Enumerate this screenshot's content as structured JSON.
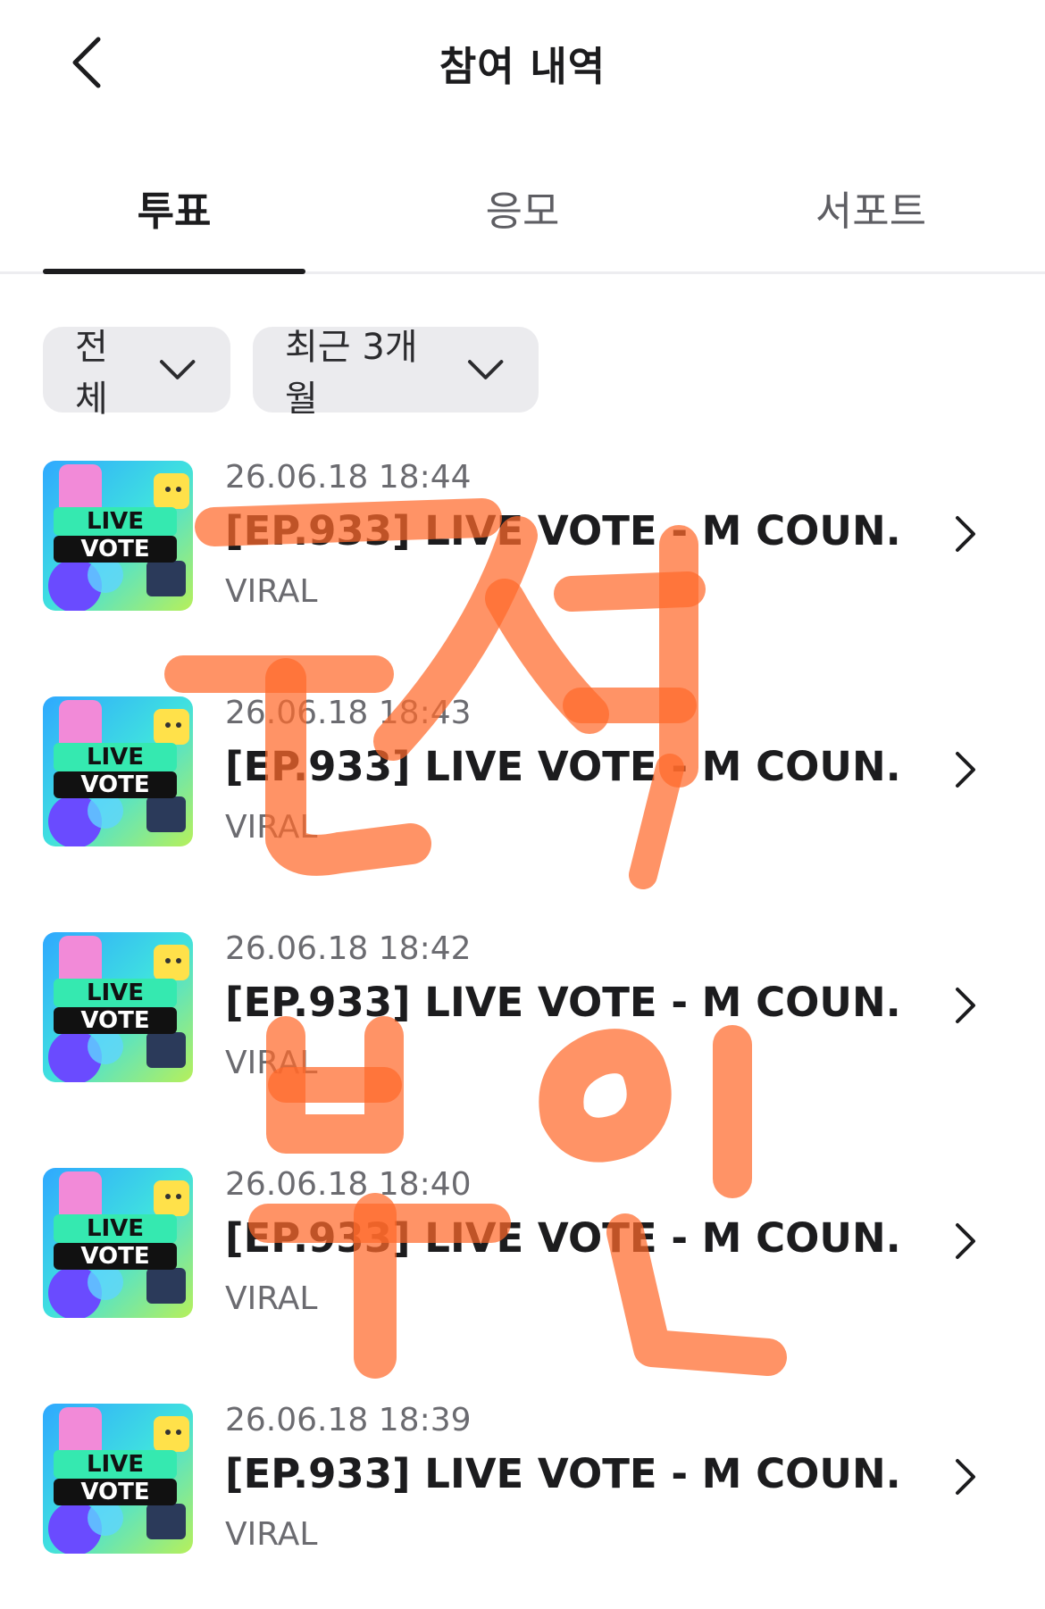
{
  "header": {
    "title": "참여 내역",
    "back_icon": "chevron-left-icon"
  },
  "tabs": [
    {
      "label": "투표",
      "active": true
    },
    {
      "label": "응모",
      "active": false
    },
    {
      "label": "서포트",
      "active": false
    }
  ],
  "filters": {
    "category": {
      "label": "전체",
      "icon": "chevron-down-icon"
    },
    "period": {
      "label": "최근 3개월",
      "icon": "chevron-down-icon"
    }
  },
  "thumbnail": {
    "line1": "LIVE",
    "line2": "VOTE"
  },
  "items": [
    {
      "date": "26.06.18 18:44",
      "title": "[EP.933] LIVE VOTE - M COUN...",
      "subtitle": "VIRAL"
    },
    {
      "date": "26.06.18 18:43",
      "title": "[EP.933] LIVE VOTE - M COUN...",
      "subtitle": "VIRAL"
    },
    {
      "date": "26.06.18 18:42",
      "title": "[EP.933] LIVE VOTE - M COUN...",
      "subtitle": "VIRAL"
    },
    {
      "date": "26.06.18 18:40",
      "title": "[EP.933] LIVE VOTE - M COUN...",
      "subtitle": "VIRAL"
    },
    {
      "date": "26.06.18 18:39",
      "title": "[EP.933] LIVE VOTE - M COUN...",
      "subtitle": "VIRAL"
    }
  ],
  "colors": {
    "scribble": "#ff6a2b",
    "pill_bg": "#ebebee",
    "text_primary": "#1c1c1e",
    "text_secondary": "#6b6b70"
  }
}
